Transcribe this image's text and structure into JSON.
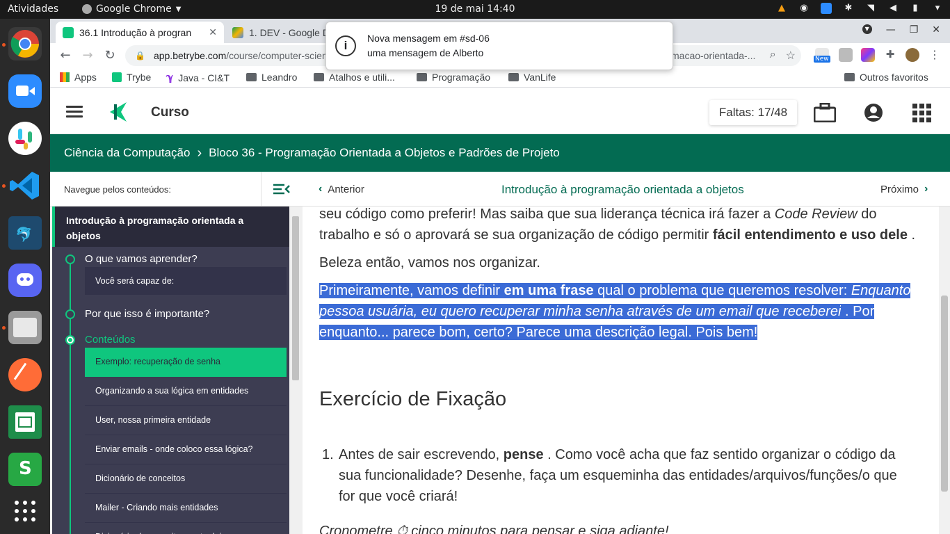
{
  "os": {
    "activities": "Atividades",
    "app_name": "Google Chrome",
    "clock": "19 de mai  14:40"
  },
  "browser": {
    "tabs": [
      {
        "label": "36.1 Introdução à progran"
      },
      {
        "label": "1. DEV - Google D"
      }
    ],
    "url_host": "app.betrybe.com",
    "url_path": "/course/computer-scien",
    "url_tail": "macao-orientada-...",
    "ext_badge": "New",
    "bookmarks": [
      {
        "label": "Apps"
      },
      {
        "label": "Trybe"
      },
      {
        "label": "Java - CI&T"
      },
      {
        "label": "Leandro"
      },
      {
        "label": "Atalhos e utili..."
      },
      {
        "label": "Programação"
      },
      {
        "label": "VanLife"
      }
    ],
    "other_bookmarks": "Outros favoritos"
  },
  "notification": {
    "title": "Nova mensagem em #sd-06",
    "body": "uma mensagem de Alberto"
  },
  "site": {
    "course_label": "Curso",
    "absences": "Faltas: 17/48",
    "breadcrumb": [
      "Ciência da Computação",
      "Bloco 36 - Programação Orientada a Objetos e Padrões de Projeto"
    ],
    "breadcrumb_sep": "›",
    "nav_label": "Navegue pelos conteúdos:",
    "prev": "Anterior",
    "current_lesson": "Introdução à programação orientada a objetos",
    "next": "Próximo",
    "accent": "#036b52",
    "highlight": "#0fc67e"
  },
  "sidebar": {
    "heading": "Introdução à programação orientada a objetos",
    "sections": [
      {
        "label": "O que vamos aprender?"
      },
      {
        "label": "Por que isso é importante?"
      },
      {
        "label": "Conteúdos"
      }
    ],
    "sub_item": "Você será capaz de:",
    "items": [
      {
        "label": "Exemplo: recuperação de senha"
      },
      {
        "label": "Organizando a sua lógica em entidades"
      },
      {
        "label": "User, nossa primeira entidade"
      },
      {
        "label": "Enviar emails - onde coloco essa lógica?"
      },
      {
        "label": "Dicionário de conceitos"
      },
      {
        "label": "Mailer - Criando mais entidades"
      },
      {
        "label": "Dicionário de conceitos parte dois"
      }
    ]
  },
  "article": {
    "p1a": "seu código como preferir! Mas saiba que sua liderança técnica irá fazer a ",
    "p1b": "Code Review",
    "p1c": " do trabalho e só o aprovará se sua organização de código permitir ",
    "p1d": "fácil entendimento e uso dele",
    "p1e": " .",
    "p2": "Beleza então, vamos nos organizar.",
    "p3a": "Primeiramente, vamos definir ",
    "p3b": "em uma frase",
    "p3c": " qual o problema que queremos resolver: ",
    "p3d": "Enquanto pessoa usuária, eu quero recuperar minha senha através de um email que receberei",
    "p3e": " . Por enquanto... parece bom, certo? Parece uma descrição legal. Pois bem!",
    "heading": "Exercício de Fixação",
    "li_num": "1.",
    "li_a": "Antes de sair escrevendo, ",
    "li_b": "pense",
    "li_c": " . Como você acha que faz sentido organizar o código da sua funcionalidade? Desenhe, faça um esqueminha das entidades/arquivos/funções/o que for que você criará!",
    "footer_text": "Cronometre ⏱ cinco minutos para pensar e siga adiante!"
  }
}
